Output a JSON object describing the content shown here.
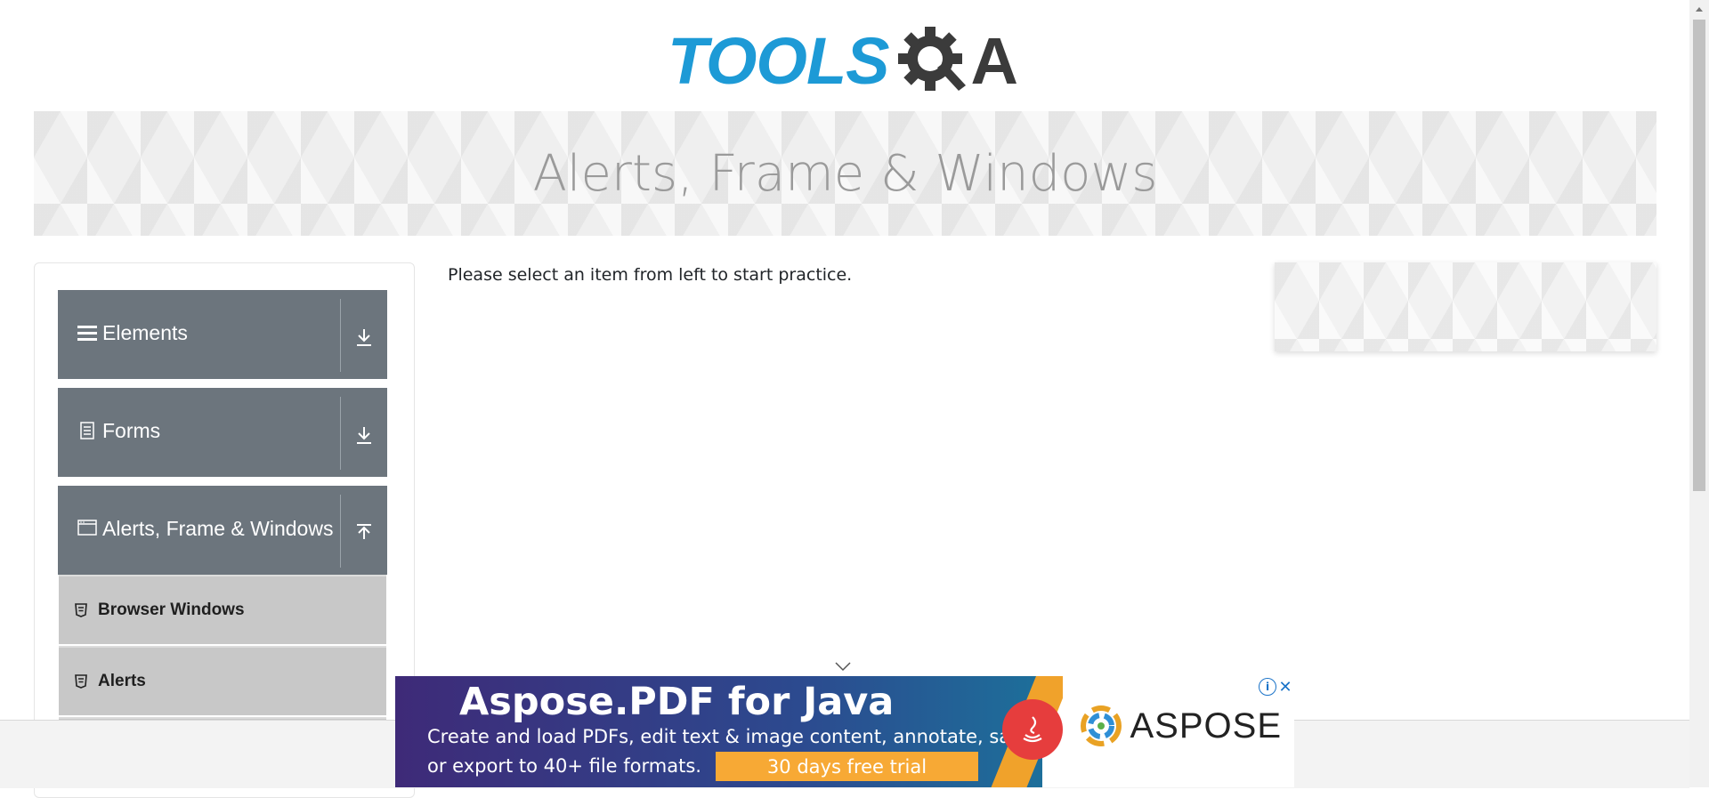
{
  "logo": {
    "part1": "TOOLS",
    "part2": "A"
  },
  "banner": {
    "title": "Alerts, Frame & Windows"
  },
  "sidebar": {
    "groups": [
      {
        "label": "Elements",
        "icon": "menu-icon",
        "toggle": "download-icon"
      },
      {
        "label": "Forms",
        "icon": "document-icon",
        "toggle": "download-icon"
      },
      {
        "label": "Alerts, Frame & Windows",
        "icon": "window-icon",
        "toggle": "upload-icon"
      }
    ],
    "items": [
      {
        "label": "Browser Windows",
        "icon": "html5-icon"
      },
      {
        "label": "Alerts",
        "icon": "html5-icon"
      }
    ]
  },
  "main": {
    "text": "Please select an item from left to start practice."
  },
  "ad": {
    "title": "Aspose.PDF for Java",
    "line1": "Create and load PDFs, edit text & image content, annotate, save,",
    "line2": "or export to 40+ file formats.",
    "cta": "30 days free trial",
    "brand": "ASPOSE"
  },
  "colors": {
    "accent": "#1d9ad6",
    "sidebar_group": "#6c757d",
    "sidebar_item": "#c8c8c8",
    "cta": "#f7a935"
  }
}
